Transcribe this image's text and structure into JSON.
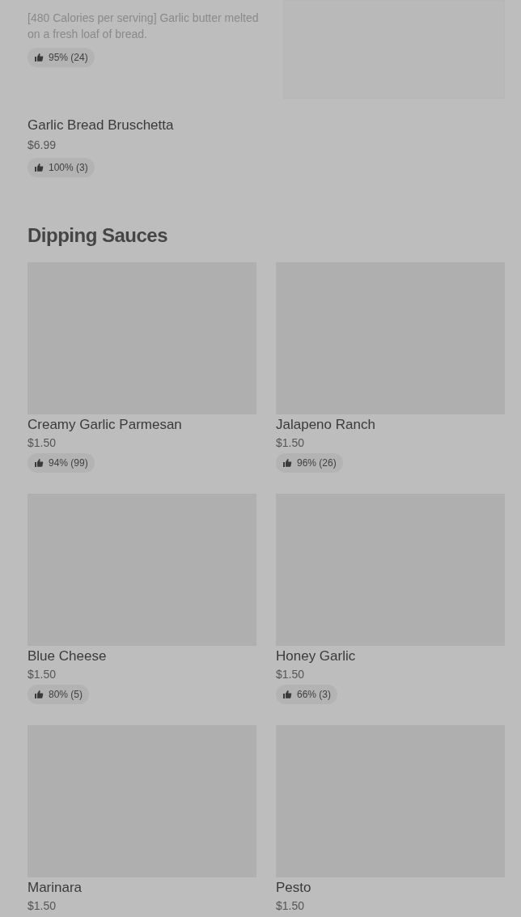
{
  "top_items": [
    {
      "kind": "with_image",
      "description": "[480 Calories per serving] Garlic butter melted on a fresh loaf of bread.",
      "rating": "95% (24)"
    },
    {
      "kind": "text_only",
      "name": "Garlic Bread Bruschetta",
      "price": "$6.99",
      "rating": "100% (3)"
    }
  ],
  "section": {
    "title": "Dipping Sauces",
    "items": [
      {
        "name": "Creamy Garlic Parmesan",
        "price": "$1.50",
        "rating": "94% (99)"
      },
      {
        "name": "Jalapeno Ranch",
        "price": "$1.50",
        "rating": "96% (26)"
      },
      {
        "name": "Blue Cheese",
        "price": "$1.50",
        "rating": "80% (5)"
      },
      {
        "name": "Honey Garlic",
        "price": "$1.50",
        "rating": "66% (3)"
      },
      {
        "name": "Marinara",
        "price": "$1.50"
      },
      {
        "name": "Pesto",
        "price": "$1.50"
      }
    ]
  }
}
